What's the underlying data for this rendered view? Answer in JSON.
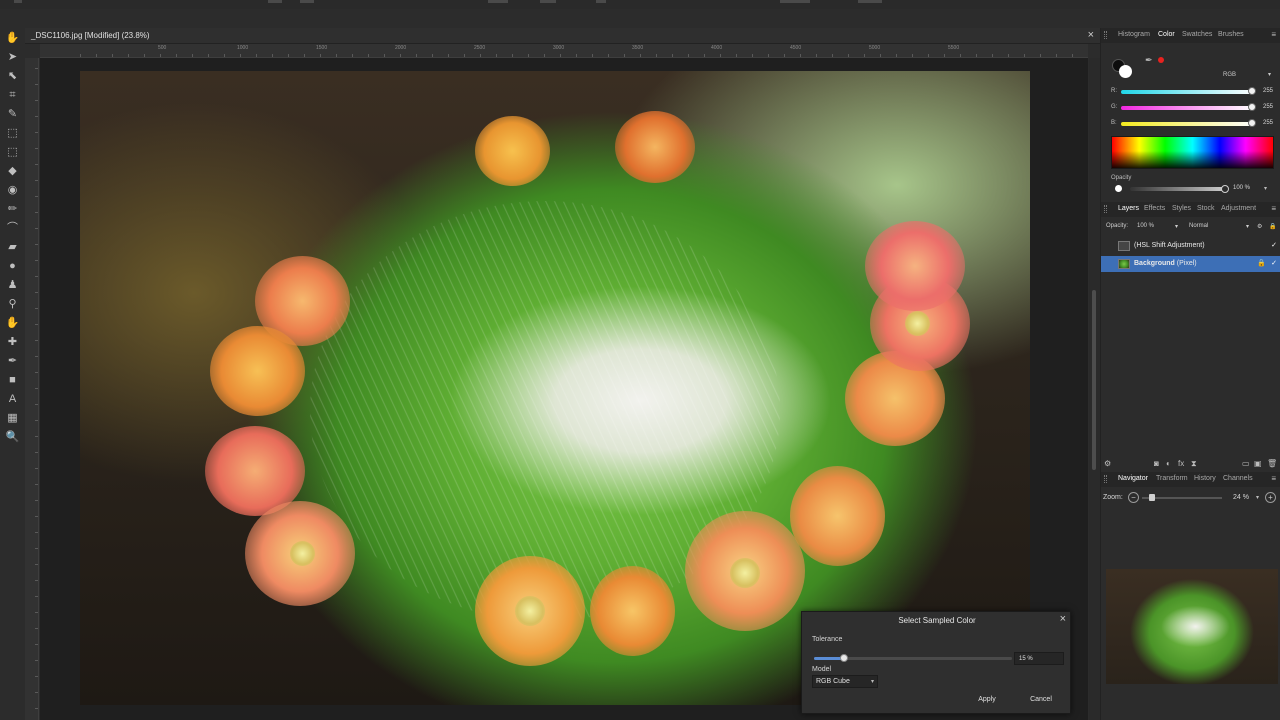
{
  "document": {
    "title": "_DSC1106.jpg [Modified] (23.8%)",
    "close_glyph": "×"
  },
  "rulers": {
    "horizontal_ticks": [
      "500",
      "1000",
      "1500",
      "2000",
      "2500",
      "3000",
      "3500",
      "4000",
      "4500",
      "5000",
      "5500"
    ]
  },
  "tools": [
    {
      "name": "view-tool-icon",
      "glyph": "✋"
    },
    {
      "name": "move-tool-icon",
      "glyph": "➤"
    },
    {
      "name": "node-tool-icon",
      "glyph": "⬉"
    },
    {
      "name": "crop-tool-icon",
      "glyph": "⌗"
    },
    {
      "name": "brush-tool-icon",
      "glyph": "✎"
    },
    {
      "name": "marquee-tool-icon",
      "glyph": "⬚"
    },
    {
      "name": "flood-select-icon",
      "glyph": "⬚"
    },
    {
      "name": "fill-tool-icon",
      "glyph": "◆"
    },
    {
      "name": "color-picker-icon",
      "glyph": "◉"
    },
    {
      "name": "paint-brush-icon",
      "glyph": "✏"
    },
    {
      "name": "selection-brush-icon",
      "glyph": "⌒"
    },
    {
      "name": "eraser-tool-icon",
      "glyph": "▰"
    },
    {
      "name": "blur-tool-icon",
      "glyph": "●"
    },
    {
      "name": "clone-tool-icon",
      "glyph": "♟"
    },
    {
      "name": "dodge-tool-icon",
      "glyph": "⚲"
    },
    {
      "name": "smudge-tool-icon",
      "glyph": "✋"
    },
    {
      "name": "healing-tool-icon",
      "glyph": "✚"
    },
    {
      "name": "pen-tool-icon",
      "glyph": "✒"
    },
    {
      "name": "shape-tool-icon",
      "glyph": "■"
    },
    {
      "name": "text-tool-icon",
      "glyph": "A"
    },
    {
      "name": "mesh-tool-icon",
      "glyph": "▦"
    },
    {
      "name": "zoom-tool-icon",
      "glyph": "🔍"
    }
  ],
  "color_panel": {
    "tabs": [
      "Histogram",
      "Color",
      "Swatches",
      "Brushes"
    ],
    "active_tab": "Color",
    "mode": "RGB",
    "channels": [
      {
        "label": "R:",
        "value": "255",
        "gradient_end": "#21d6e8"
      },
      {
        "label": "G:",
        "value": "255",
        "gradient_end": "#f227e0"
      },
      {
        "label": "B:",
        "value": "255",
        "gradient_end": "#f4ea1f"
      }
    ],
    "opacity_label": "Opacity",
    "opacity_value": "100 %",
    "fg_color": "#0d0d0d",
    "bg_color": "#ffffff",
    "accent_color": "#e8221f"
  },
  "layers_panel": {
    "tabs": [
      "Layers",
      "Effects",
      "Styles",
      "Stock",
      "Adjustment"
    ],
    "active_tab": "Layers",
    "opacity_label": "Opacity:",
    "opacity_value": "100 %",
    "blend_mode": "Normal",
    "layers": [
      {
        "name": "(HSL Shift Adjustment)",
        "selected": false
      },
      {
        "name": "Background",
        "suffix": "(Pixel)",
        "selected": true
      }
    ]
  },
  "navigator_panel": {
    "tabs": [
      "Navigator",
      "Transform",
      "History",
      "Channels"
    ],
    "active_tab": "Navigator",
    "zoom_label": "Zoom:",
    "zoom_value": "24 %"
  },
  "dialog": {
    "title": "Select Sampled Color",
    "tolerance_label": "Tolerance",
    "tolerance_value": "15 %",
    "tolerance_fraction": 0.15,
    "model_label": "Model",
    "model_value": "RGB Cube",
    "apply_label": "Apply",
    "cancel_label": "Cancel"
  }
}
